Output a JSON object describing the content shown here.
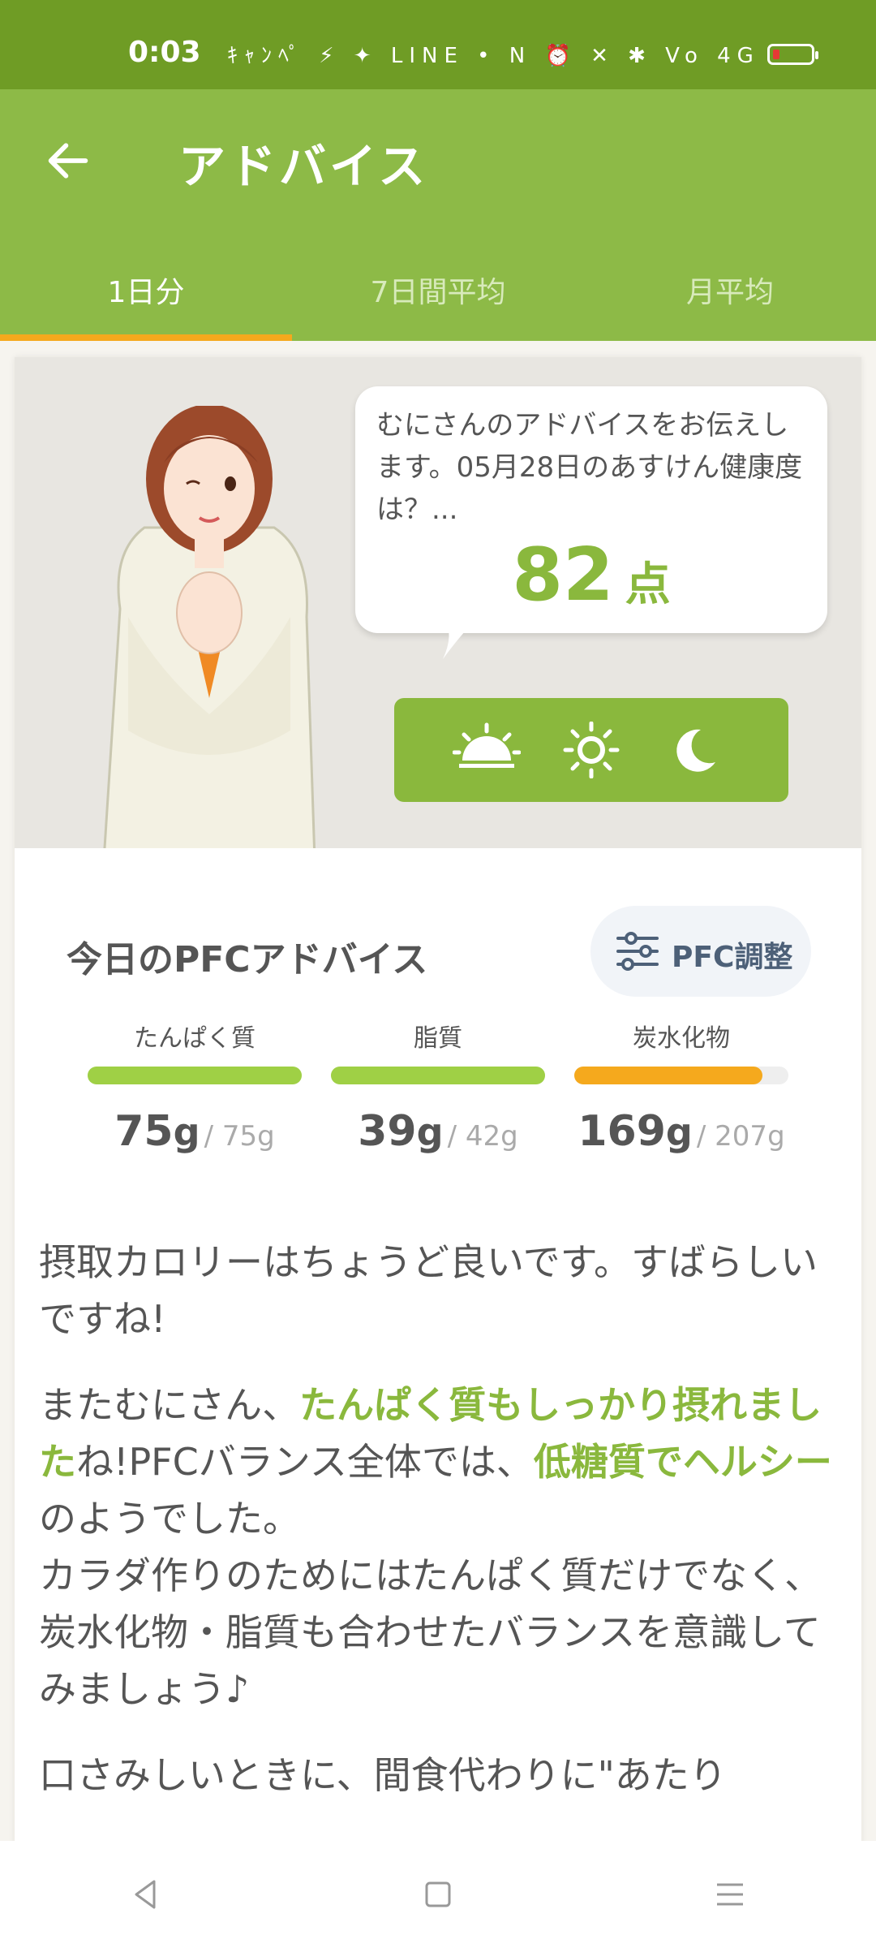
{
  "status": {
    "time": "0:03",
    "icons": "ｷｬﾝﾍﾟ ⚡ ✦ LINE • N ⏰ ✕ ✱ Vo 4G"
  },
  "header": {
    "title": "アドバイス"
  },
  "tabs": [
    {
      "label": "1日分",
      "active": true
    },
    {
      "label": "7日間平均",
      "active": false
    },
    {
      "label": "月平均",
      "active": false
    }
  ],
  "advice_card": {
    "message": "むにさんのアドバイスをお伝えします。05月28日のあすけん健康度は？...",
    "score": "82",
    "score_unit": "点",
    "time_buttons": [
      "sunrise-icon",
      "sun-icon",
      "moon-icon"
    ]
  },
  "pfc": {
    "title": "今日のPFCアドバイス",
    "adjust_label": "PFC調整",
    "items": [
      {
        "label": "たんぱく質",
        "value": "75",
        "unit": "g",
        "target": "/ 75g",
        "fill": 1.0,
        "color": "#9fd045"
      },
      {
        "label": "脂質",
        "value": "39",
        "unit": "g",
        "target": "/ 42g",
        "fill": 1.0,
        "color": "#9fd045"
      },
      {
        "label": "炭水化物",
        "value": "169",
        "unit": "g",
        "target": "/ 207g",
        "fill": 0.88,
        "color": "#f5a91d"
      }
    ]
  },
  "advice": {
    "p1": "摂取カロリーはちょうど良いです。すばらしいですね!",
    "p2_a": "またむにさん、",
    "p2_hl1": "たんぱく質もしっかり摂れました",
    "p2_b": "ね!PFCバランス全体では、",
    "p2_hl2": "低糖質でヘルシー",
    "p2_c": "のようでした。",
    "p2_d": "カラダ作りのためにはたんぱく質だけでなく、炭水化物・脂質も合わせたバランスを意識してみましょう♪",
    "p3": "口さみしいときに、間食代わりに\"あたり"
  },
  "colors": {
    "appbar": "#8dba47",
    "statusbar": "#6f9c25",
    "accent": "#8ab83d",
    "tab_indicator": "#f5a91d"
  }
}
